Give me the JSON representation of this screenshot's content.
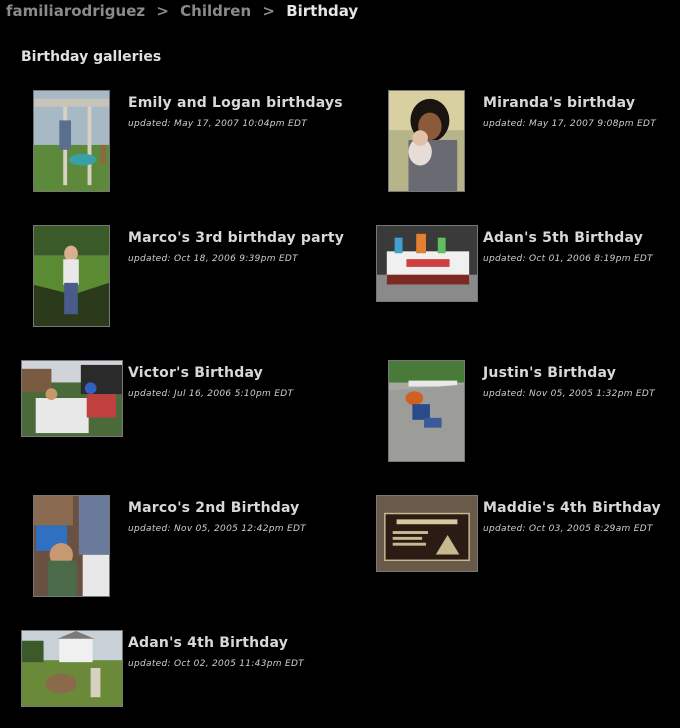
{
  "breadcrumb": {
    "items": [
      "familiarodriguez",
      "Children",
      "Birthday"
    ],
    "separator": ">"
  },
  "section_title": "Birthday galleries",
  "galleries": [
    {
      "title": "Emily and Logan birthdays",
      "updated": "updated: May 17, 2007 10:04pm EDT"
    },
    {
      "title": "Miranda's birthday",
      "updated": "updated: May 17, 2007 9:08pm EDT"
    },
    {
      "title": "Marco's 3rd birthday party",
      "updated": "updated: Oct 18, 2006 9:39pm EDT"
    },
    {
      "title": "Adan's 5th Birthday",
      "updated": "updated: Oct 01, 2006 8:19pm EDT"
    },
    {
      "title": "Victor's Birthday",
      "updated": "updated: Jul 16, 2006 5:10pm EDT"
    },
    {
      "title": "Justin's Birthday",
      "updated": "updated: Nov 05, 2005 1:32pm EDT"
    },
    {
      "title": "Marco's 2nd Birthday",
      "updated": "updated: Nov 05, 2005 12:42pm EDT"
    },
    {
      "title": "Maddie's 4th Birthday",
      "updated": "updated: Oct 03, 2005 8:29am EDT"
    },
    {
      "title": "Adan's 4th Birthday",
      "updated": "updated: Oct 02, 2005 11:43pm EDT"
    }
  ],
  "colors": {
    "background": "#000000",
    "breadcrumb": "#8a8a8a",
    "current": "#e6e6e6",
    "title": "#d8d8d8",
    "thumb_border": "#777777"
  }
}
